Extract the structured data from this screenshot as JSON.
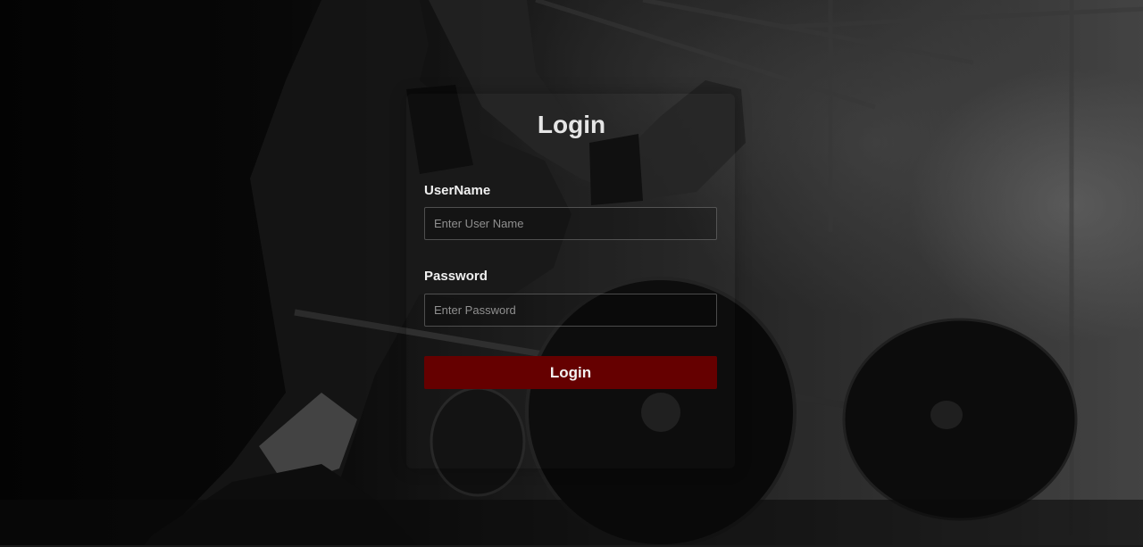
{
  "login": {
    "title": "Login",
    "username": {
      "label": "UserName",
      "placeholder": "Enter User Name",
      "value": ""
    },
    "password": {
      "label": "Password",
      "placeholder": "Enter Password",
      "value": ""
    },
    "submit_label": "Login"
  },
  "theme": {
    "button_color": "#650000",
    "text_color": "#f0f0f0",
    "background_image": "gym-barbell-photo"
  }
}
